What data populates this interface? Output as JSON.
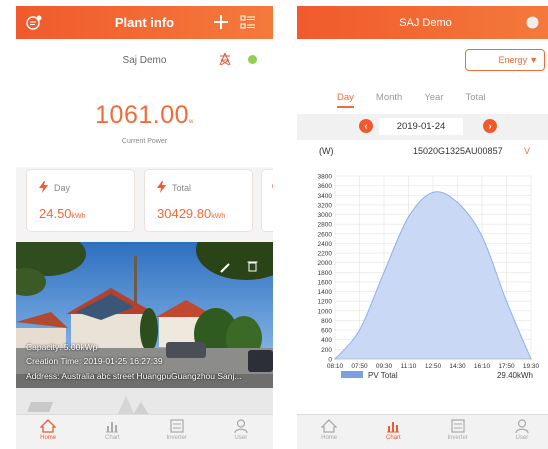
{
  "left": {
    "header": {
      "title": "Plant info",
      "icons": [
        "message-icon",
        "add-icon",
        "list-icon"
      ]
    },
    "plant_name": "Saj Demo",
    "current_power": {
      "value": "1061.00",
      "unit": "w",
      "label": "Current Power"
    },
    "cards": [
      {
        "label": "Day",
        "value": "24.50",
        "unit": "kWh"
      },
      {
        "label": "Total",
        "value": "30429.80",
        "unit": "kWh"
      }
    ],
    "photo": {
      "capacity": "Capacity: 5.00kWp",
      "creation_time": "Creation Time: 2019-01-25 16:27:39",
      "address": "Address: Australia abc street HuangpuGuangzhou Sanj..."
    },
    "tabs": [
      "Home",
      "Chart",
      "Inverter",
      "User"
    ],
    "active_tab": "Home"
  },
  "right": {
    "header": {
      "title": "SAJ Demo"
    },
    "energy_button": "Energy",
    "period_tabs": [
      "Day",
      "Month",
      "Year",
      "Total"
    ],
    "active_period": "Day",
    "date": "2019-01-24",
    "unit_label": "(W)",
    "device": "15020G1325AU00857",
    "device_caret": "V",
    "legend": "PV Total",
    "total": "29.40kWh",
    "tabs": [
      "Home",
      "Chart",
      "Inverter",
      "User"
    ],
    "active_tab": "Chart"
  },
  "colors": {
    "accent": "#f05a2c",
    "chart_fill": "#c9d9f5",
    "chart_line": "#8fb0e8",
    "status": "#8fd14f"
  },
  "chart_data": {
    "type": "area",
    "x": [
      "08:10",
      "07:50",
      "09:30",
      "11:10",
      "12:50",
      "14:30",
      "16:10",
      "17:50",
      "19:30"
    ],
    "series": [
      {
        "name": "PV Total",
        "values": [
          0,
          600,
          1800,
          2950,
          3460,
          3250,
          2550,
          1200,
          0
        ]
      }
    ],
    "ylim": [
      0,
      3800
    ],
    "yticks": [
      0,
      200,
      400,
      600,
      800,
      1000,
      1200,
      1400,
      1600,
      1800,
      2000,
      2200,
      2400,
      2600,
      2800,
      3000,
      3200,
      3400,
      3600,
      3800
    ],
    "ylabel": "(W)",
    "grid": true
  }
}
